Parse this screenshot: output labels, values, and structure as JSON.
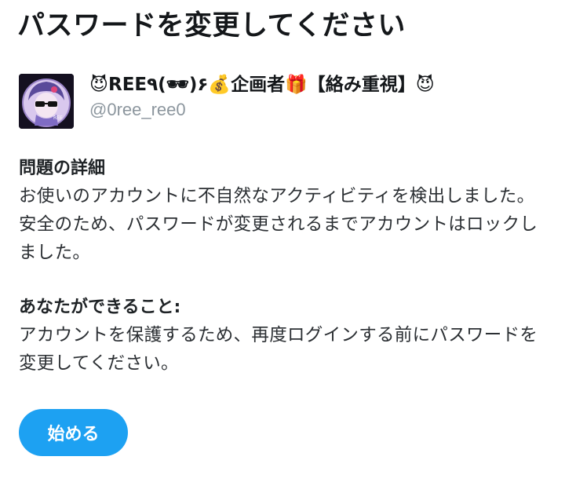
{
  "page": {
    "title": "パスワードを変更してください"
  },
  "account": {
    "display_name": "😈REE٩(🕶)۶💰企画者🎁【絡み重視】😈",
    "handle": "@0ree_ree0",
    "avatar_icon": "profile-avatar"
  },
  "details": {
    "heading": "問題の詳細",
    "body": "お使いのアカウントに不自然なアクティビティを検出しました。安全のため、パスワードが変更されるまでアカウントはロックしました。"
  },
  "action": {
    "heading": "あなたができること:",
    "body": "アカウントを保護するため、再度ログインする前にパスワードを変更してください。"
  },
  "button": {
    "label": "始める",
    "color": "#1da1f2"
  }
}
